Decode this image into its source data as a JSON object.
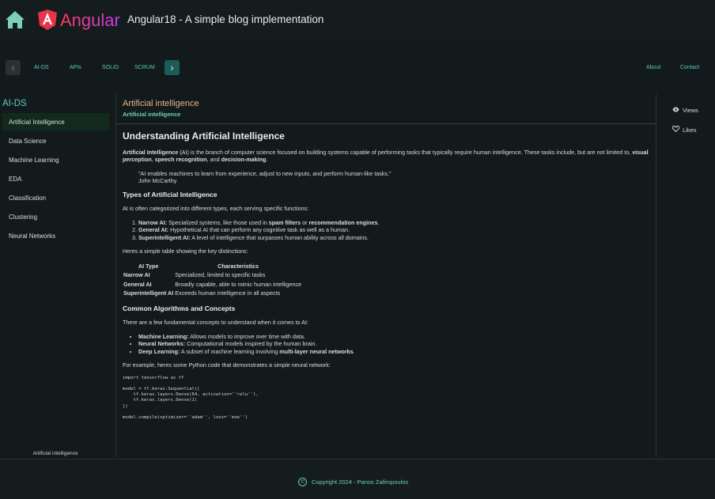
{
  "header": {
    "brand": "Angular",
    "app_title": "Angular18 - A simple blog implementation",
    "home_icon": "home-icon",
    "logo_icon": "angular-logo-icon"
  },
  "nav": {
    "prev_glyph": "‹",
    "next_glyph": "›",
    "links": [
      "AI-DS",
      "APIs",
      "SOLID",
      "SCRUM"
    ],
    "right_links": [
      "About",
      "Contact"
    ]
  },
  "sidebar": {
    "title": "AI-DS",
    "items": [
      {
        "label": "Artificial Intelligence",
        "active": true
      },
      {
        "label": "Data Science",
        "active": false
      },
      {
        "label": "Machine Learning",
        "active": false
      },
      {
        "label": "EDA",
        "active": false
      },
      {
        "label": "Classification",
        "active": false
      },
      {
        "label": "Clustering",
        "active": false
      },
      {
        "label": "Neural Networks",
        "active": false
      }
    ],
    "footer": "Artificial intelligence"
  },
  "main": {
    "title": "Artificial intelligence",
    "subtitle": "Artificial intelligence",
    "heading": "Understanding Artificial Intelligence",
    "intro": {
      "b1": "Artificial Intelligence",
      "t1": " (AI) is the branch of computer science focused on building systems capable of performing tasks that typically require human intelligence. These tasks include, but are not limited to, ",
      "b2": "visual perception",
      "t2": ", ",
      "b3": "speech recognition",
      "t3": ", and ",
      "b4": "decision-making",
      "t4": "."
    },
    "quote": "\"AI enables machines to learn from experience, adjust to new inputs, and perform human-like tasks.\"",
    "quote_author": "John McCarthy",
    "types_heading": "Types of Artificial Intelligence",
    "types_intro": "AI is often categorized into different types, each serving specific functions:",
    "types": [
      {
        "b": "Narrow AI:",
        "t": " Specialized systems, like those used in ",
        "b2": "spam filters",
        "t2": " or ",
        "b3": "recommendation engines",
        "t3": "."
      },
      {
        "b": "General AI:",
        "t": " Hypothetical AI that can perform any cognitive task as well as a human."
      },
      {
        "b": "Superintelligent AI:",
        "t": " A level of intelligence that surpasses human ability across all domains."
      }
    ],
    "table_intro": "Heres a simple table showing the key distinctions:",
    "table": {
      "headers": [
        "AI Type",
        "Characteristics"
      ],
      "rows": [
        [
          "Narrow AI",
          "Specialized, limited to specific tasks"
        ],
        [
          "General AI",
          "Broadly capable, able to mimic human intelligence"
        ],
        [
          "Superintelligent AI",
          "Exceeds human intelligence in all aspects"
        ]
      ]
    },
    "algos_heading": "Common Algorithms and Concepts",
    "algos_intro": "There are a few fundamental concepts to understand when it comes to AI:",
    "algos": [
      {
        "b": "Machine Learning:",
        "t": " Allows models to improve over time with data."
      },
      {
        "b": "Neural Networks:",
        "t": " Computational models inspired by the human brain."
      },
      {
        "b": "Deep Learning:",
        "t": " A subset of machine learning involving ",
        "b2": "multi-layer neural networks",
        "t2": "."
      }
    ],
    "code_intro": "For example, heres some Python code that demonstrates a simple neural network:",
    "code": "import tensorflow as tf\n\nmodel = tf.keras.Sequential([\n    tf.keras.layers.Dense(64, activation=''relu''),\n    tf.keras.layers.Dense(1)\n])\n\nmodel.compile(optimizer=''adam'', loss=''mse'')"
  },
  "rightbar": {
    "views_label": "Views",
    "likes_label": "Likes",
    "views_icon": "eye-icon",
    "likes_icon": "heart-icon"
  },
  "footer": {
    "copyright": "Copyright 2024 - Panos Zafiropoulos",
    "copy_glyph": "©"
  }
}
